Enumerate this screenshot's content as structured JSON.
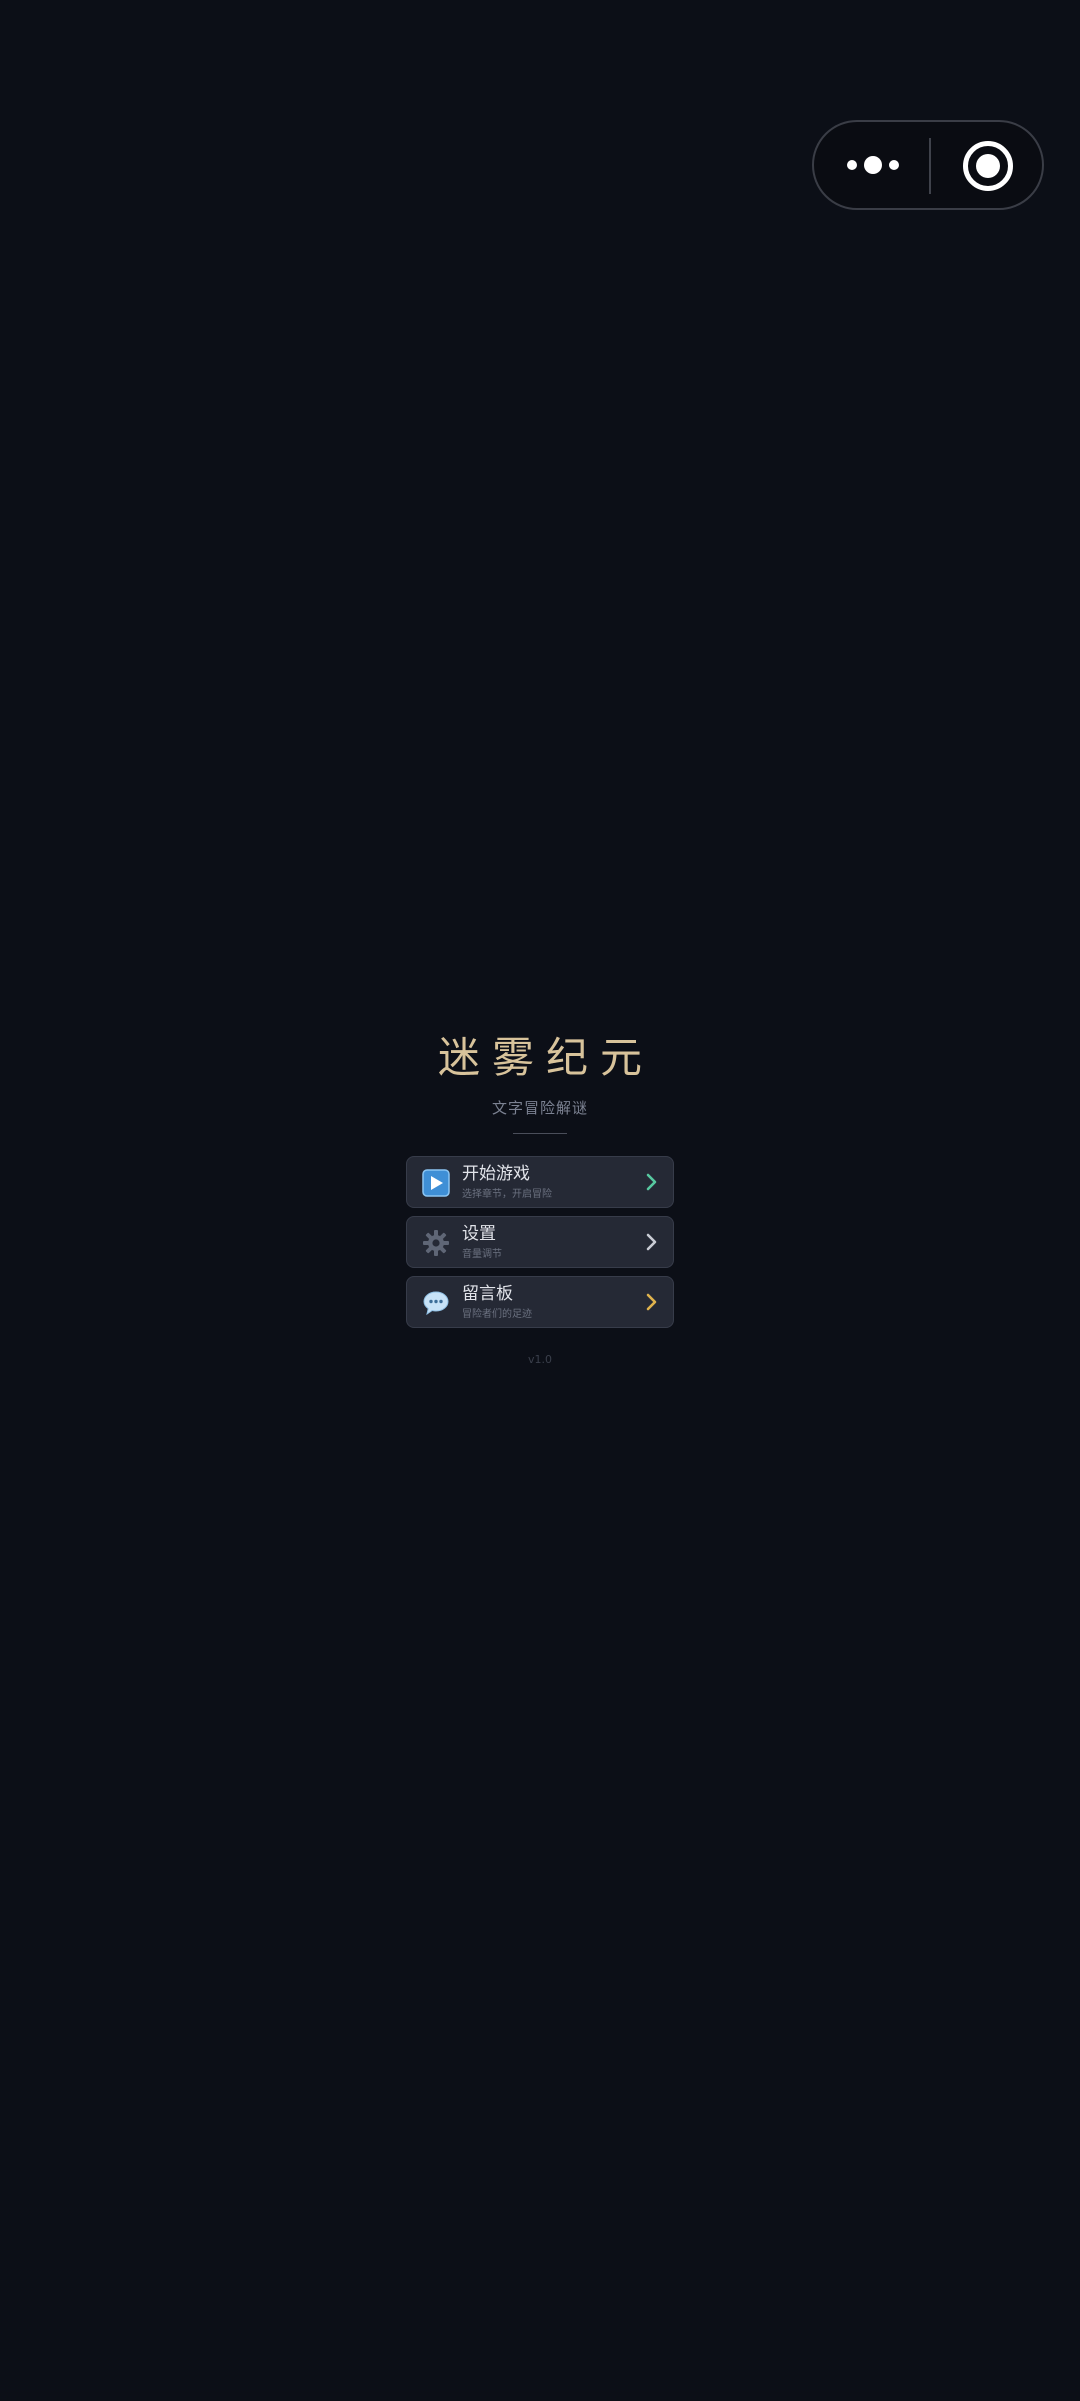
{
  "capsule": {
    "more_icon": "more-dots-icon",
    "close_icon": "close-target-icon"
  },
  "header": {
    "title": "迷雾纪元",
    "subtitle": "文字冒险解谜"
  },
  "menu": {
    "items": [
      {
        "label": "开始游戏",
        "desc": "选择章节，开启冒险",
        "icon": "play-icon",
        "chevron_color": "#57c9a0"
      },
      {
        "label": "设置",
        "desc": "音量调节",
        "icon": "gear-icon",
        "chevron_color": "#c9ccd5"
      },
      {
        "label": "留言板",
        "desc": "冒险者们的足迹",
        "icon": "speech-bubble-icon",
        "chevron_color": "#e0b34d"
      }
    ]
  },
  "footer": {
    "version": "v1.0"
  },
  "colors": {
    "background": "#0c0f17",
    "title": "#d8c39b",
    "card_bg": "#252935",
    "card_border": "#373c4a"
  }
}
